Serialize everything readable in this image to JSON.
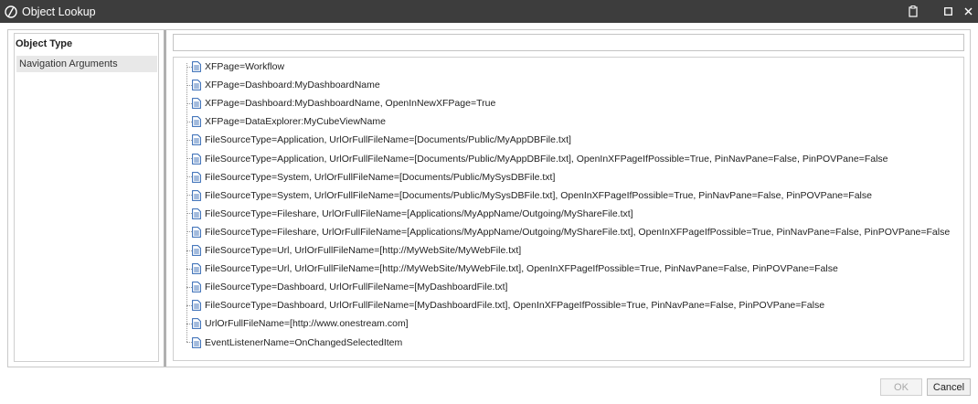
{
  "window": {
    "title": "Object Lookup"
  },
  "left_panel": {
    "heading": "Object Type",
    "selected_item": "Navigation Arguments"
  },
  "search": {
    "value": ""
  },
  "items": [
    "XFPage=Workflow",
    "XFPage=Dashboard:MyDashboardName",
    "XFPage=Dashboard:MyDashboardName, OpenInNewXFPage=True",
    "XFPage=DataExplorer:MyCubeViewName",
    "FileSourceType=Application, UrlOrFullFileName=[Documents/Public/MyAppDBFile.txt]",
    "FileSourceType=Application, UrlOrFullFileName=[Documents/Public/MyAppDBFile.txt], OpenInXFPageIfPossible=True, PinNavPane=False, PinPOVPane=False",
    "FileSourceType=System, UrlOrFullFileName=[Documents/Public/MySysDBFile.txt]",
    "FileSourceType=System, UrlOrFullFileName=[Documents/Public/MySysDBFile.txt], OpenInXFPageIfPossible=True, PinNavPane=False, PinPOVPane=False",
    "FileSourceType=Fileshare, UrlOrFullFileName=[Applications/MyAppName/Outgoing/MyShareFile.txt]",
    "FileSourceType=Fileshare, UrlOrFullFileName=[Applications/MyAppName/Outgoing/MyShareFile.txt], OpenInXFPageIfPossible=True, PinNavPane=False, PinPOVPane=False",
    "FileSourceType=Url, UrlOrFullFileName=[http://MyWebSite/MyWebFile.txt]",
    "FileSourceType=Url, UrlOrFullFileName=[http://MyWebSite/MyWebFile.txt], OpenInXFPageIfPossible=True, PinNavPane=False, PinPOVPane=False",
    "FileSourceType=Dashboard, UrlOrFullFileName=[MyDashboardFile.txt]",
    "FileSourceType=Dashboard, UrlOrFullFileName=[MyDashboardFile.txt], OpenInXFPageIfPossible=True, PinNavPane=False, PinPOVPane=False",
    "UrlOrFullFileName=[http://www.onestream.com]",
    "EventListenerName=OnChangedSelectedItem"
  ],
  "buttons": {
    "ok": "OK",
    "cancel": "Cancel"
  },
  "icons": {
    "title_logo": "onestream-logo-icon",
    "clipboard": "clipboard-icon",
    "maximize": "maximize-icon",
    "close": "close-icon",
    "item": "document-icon"
  },
  "colors": {
    "titlebar": "#3d3d3d",
    "selected_item_bg": "#e8e8e8",
    "icon_blue": "#2f66b3"
  }
}
